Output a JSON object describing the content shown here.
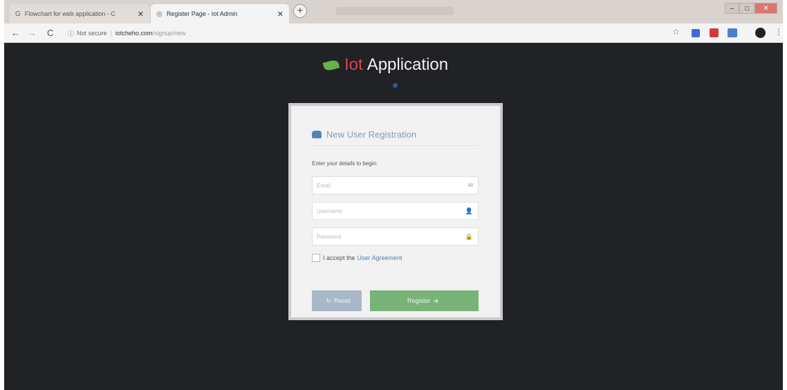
{
  "browser": {
    "tabs": [
      {
        "title": "Flowchart for web application - C",
        "active": false
      },
      {
        "title": "Register Page - Iot Admin",
        "active": true
      }
    ],
    "new_tab_label": "+",
    "address": {
      "security": "Not secure",
      "host": "iotcheho.com",
      "path": "/signup/new"
    }
  },
  "brand": {
    "iot": "Iot",
    "app": "Application"
  },
  "form": {
    "title": "New User Registration",
    "intro": "Enter your details to begin:",
    "email_placeholder": "Email",
    "username_placeholder": "Username",
    "password_placeholder": "Password",
    "agree_text": "I accept the",
    "agree_link": "User Agreement",
    "reset_label": "Reset",
    "register_label": "Register"
  },
  "colors": {
    "page_bg": "#202226",
    "iot_red": "#d9454d",
    "leaf_green": "#68b04a",
    "register_green": "#78b378",
    "reset_gray": "#a8b8c6"
  },
  "icons": [
    "leaf-icon",
    "users-icon",
    "envelope-icon",
    "user-icon",
    "lock-icon",
    "refresh-icon",
    "arrow-right-icon"
  ]
}
